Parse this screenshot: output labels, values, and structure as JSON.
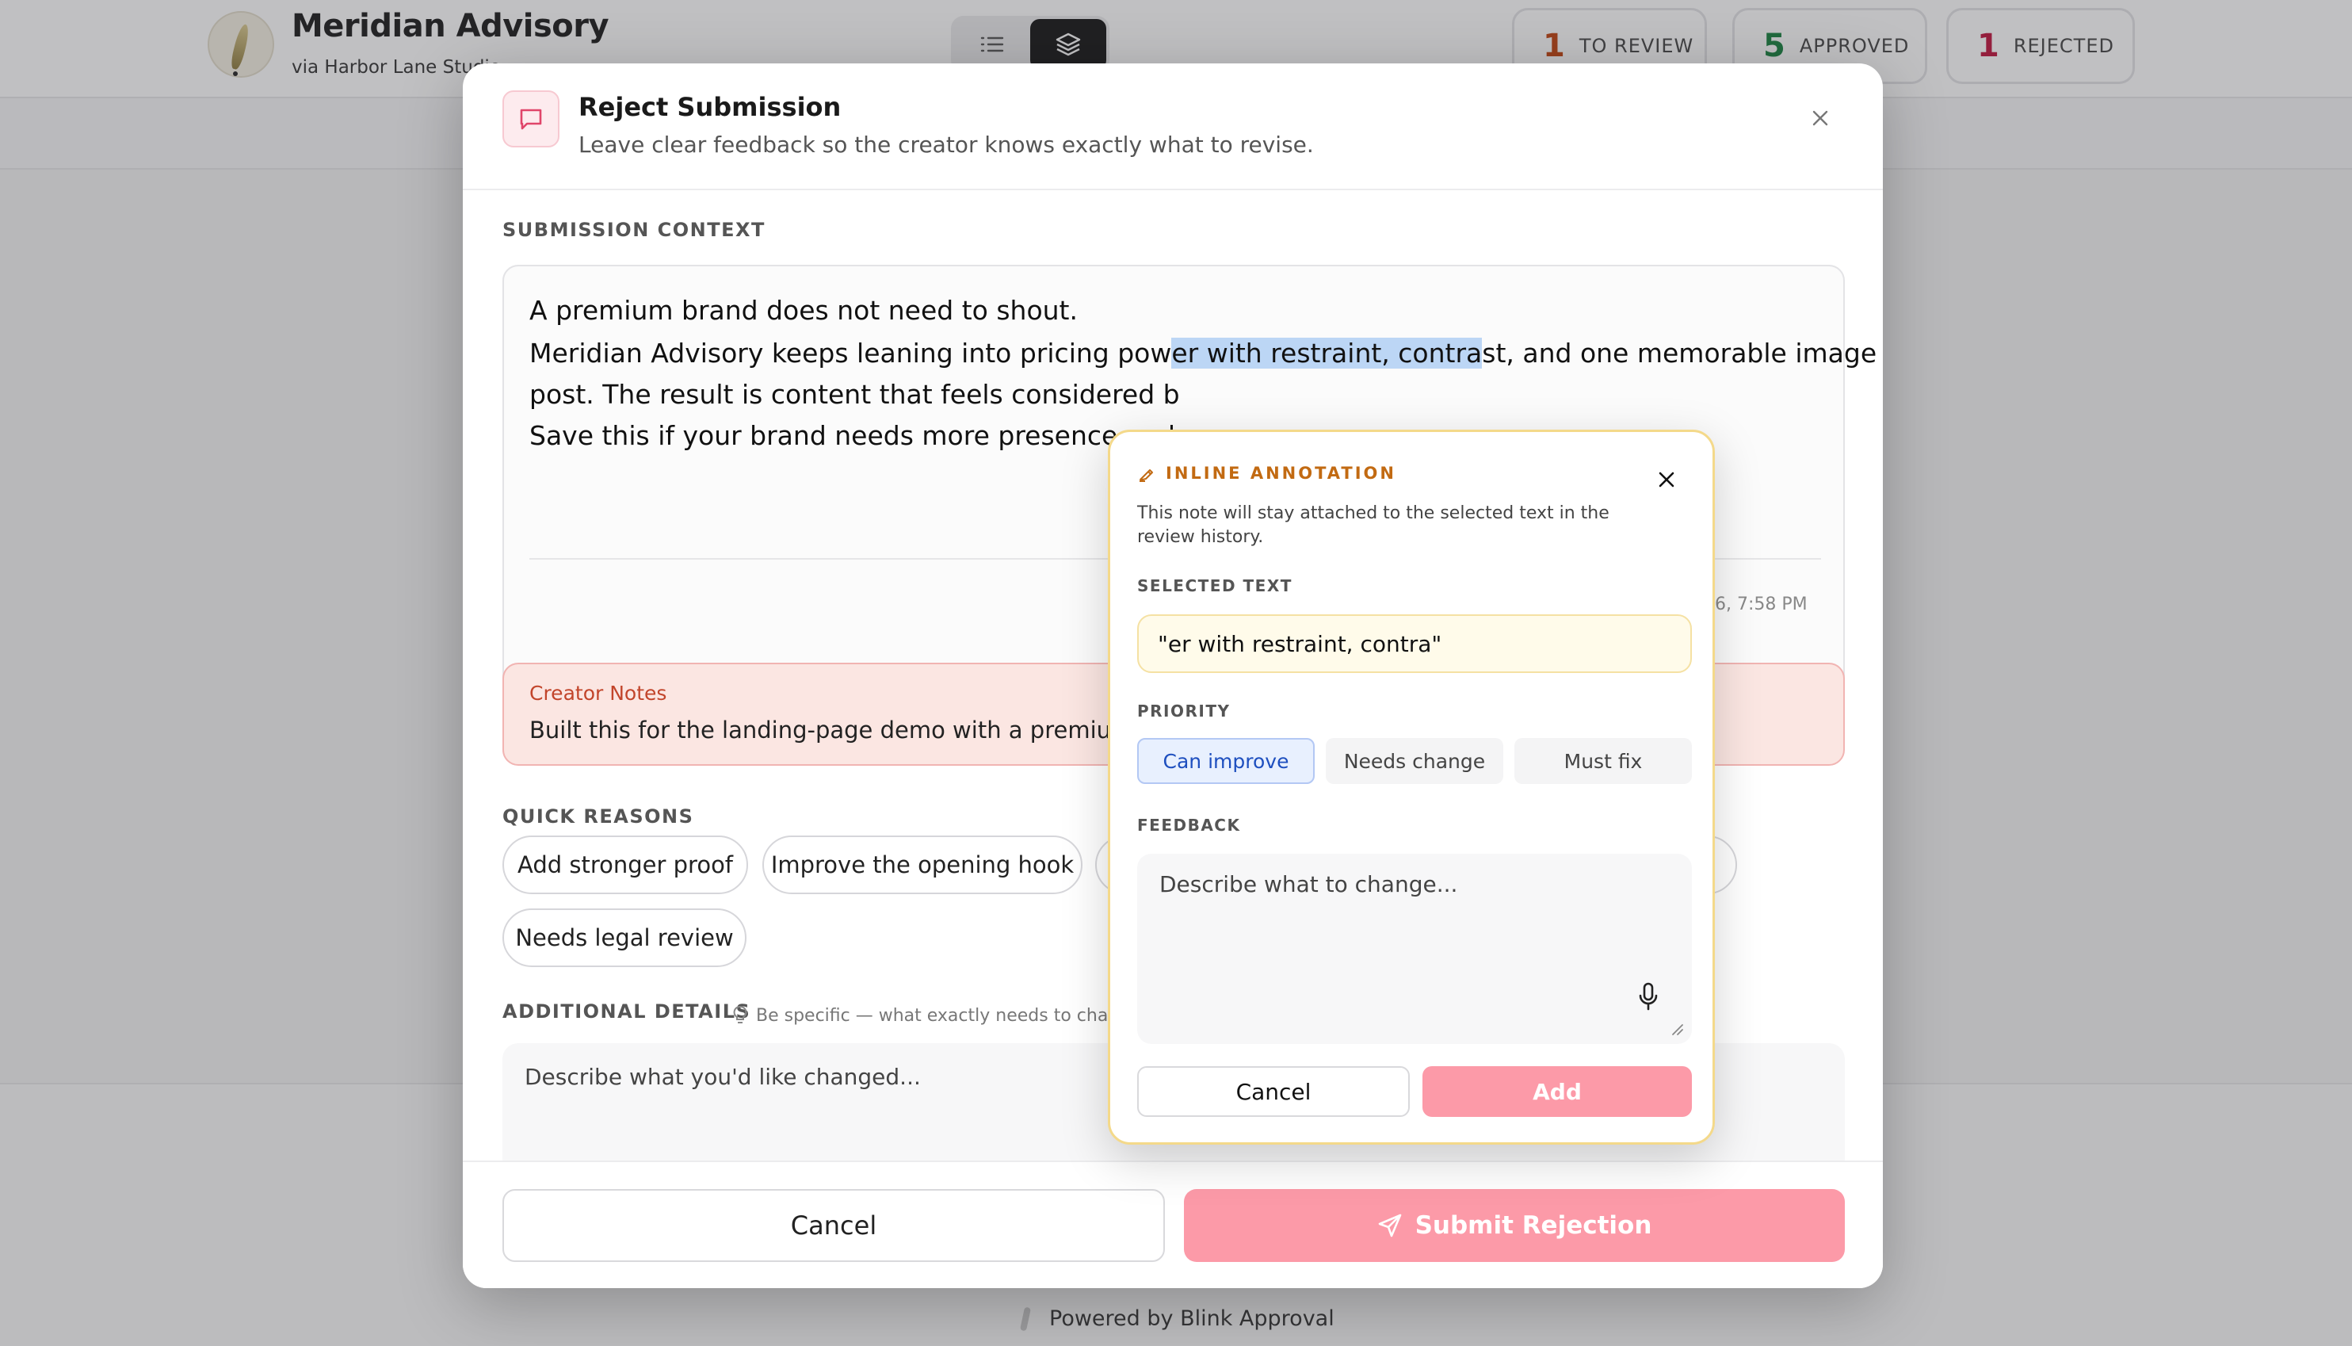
{
  "app": {
    "brand_name": "Meridian Advisory",
    "brand_via": "via Harbor Lane Studio",
    "stats": [
      {
        "count": "1",
        "label": "TO REVIEW",
        "color": "#c2410c"
      },
      {
        "count": "5",
        "label": "APPROVED",
        "color": "#15803d"
      },
      {
        "count": "1",
        "label": "REJECTED",
        "color": "#be123c"
      }
    ],
    "footer": "Powered by Blink Approval"
  },
  "modal": {
    "title": "Reject Submission",
    "description": "Leave clear feedback so the creator knows exactly what to revise.",
    "context_label": "SUBMISSION CONTEXT",
    "context": {
      "line1": "A premium brand does not need to shout.",
      "line2_before": "Meridian Advisory keeps leaning into pricing pow",
      "line2_highlight": "er with restraint, contra",
      "line2_after": "st, and one memorable image per",
      "line3": "post. The result is content that feels considered b",
      "line4": "Save this if your brand needs more presence and",
      "timestamp": "026, 7:58 PM"
    },
    "creator_notes_title": "Creator Notes",
    "creator_notes_text": "Built this for the landing-page demo with a premium voic",
    "quick_reasons_label": "QUICK REASONS",
    "quick_reasons": [
      "Add stronger proof",
      "Improve the opening hook",
      "Needs legal review"
    ],
    "details_label": "ADDITIONAL DETAILS",
    "details_hint": "Be specific — what exactly needs to chang",
    "details_placeholder": "Describe what you'd like changed...",
    "cancel_label": "Cancel",
    "submit_label": "Submit Rejection",
    "accent_color": "#fc9aa8"
  },
  "annotation": {
    "eyebrow": "INLINE ANNOTATION",
    "description": "This note will stay attached to the selected text in the review history.",
    "selected_label": "SELECTED TEXT",
    "selected_text": "\"er with restraint, contra\"",
    "priority_label": "PRIORITY",
    "priorities": [
      "Can improve",
      "Needs change",
      "Must fix"
    ],
    "selected_priority": "Can improve",
    "feedback_label": "FEEDBACK",
    "feedback_placeholder": "Describe what to change...",
    "cancel_label": "Cancel",
    "add_label": "Add"
  }
}
